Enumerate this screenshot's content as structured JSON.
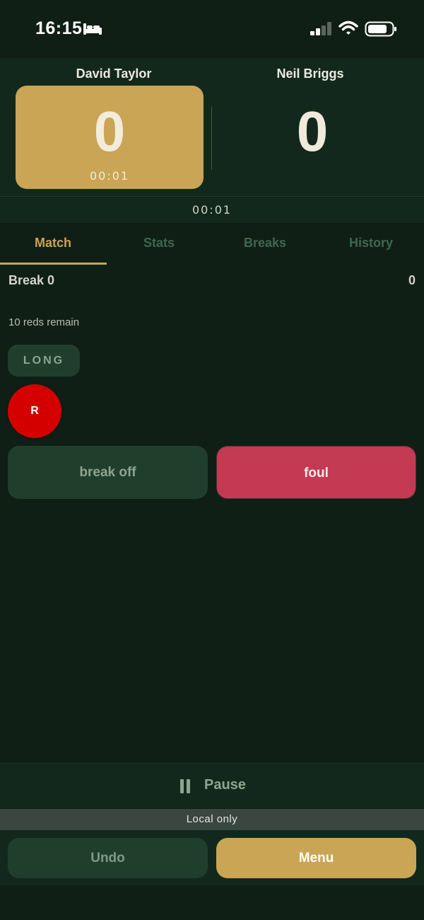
{
  "status_bar": {
    "time": "16:15",
    "icons": [
      "bed-icon",
      "signal-icon",
      "wifi-icon",
      "battery-icon"
    ]
  },
  "players": [
    {
      "name": "David Taylor",
      "score": "0",
      "timer": "00:01"
    },
    {
      "name": "Neil Briggs",
      "score": "0"
    }
  ],
  "match_timer": "00:01",
  "tabs": [
    {
      "label": "Match",
      "active": true
    },
    {
      "label": "Stats",
      "active": false
    },
    {
      "label": "Breaks",
      "active": false
    },
    {
      "label": "History",
      "active": false
    }
  ],
  "match": {
    "break_label": "Break 0",
    "break_score": "0",
    "reds_remain": "10 reds remain",
    "long_label": "LONG",
    "ball_label": "R",
    "break_off_label": "break off",
    "foul_label": "foul"
  },
  "controls": {
    "pause_label": "Pause",
    "local_only": "Local only",
    "undo_label": "Undo",
    "menu_label": "Menu"
  },
  "colors": {
    "background": "#0f1f16",
    "panel": "#13281c",
    "accent_gold": "#c9a555",
    "foul_red": "#c33a52",
    "ball_red": "#d40000"
  }
}
